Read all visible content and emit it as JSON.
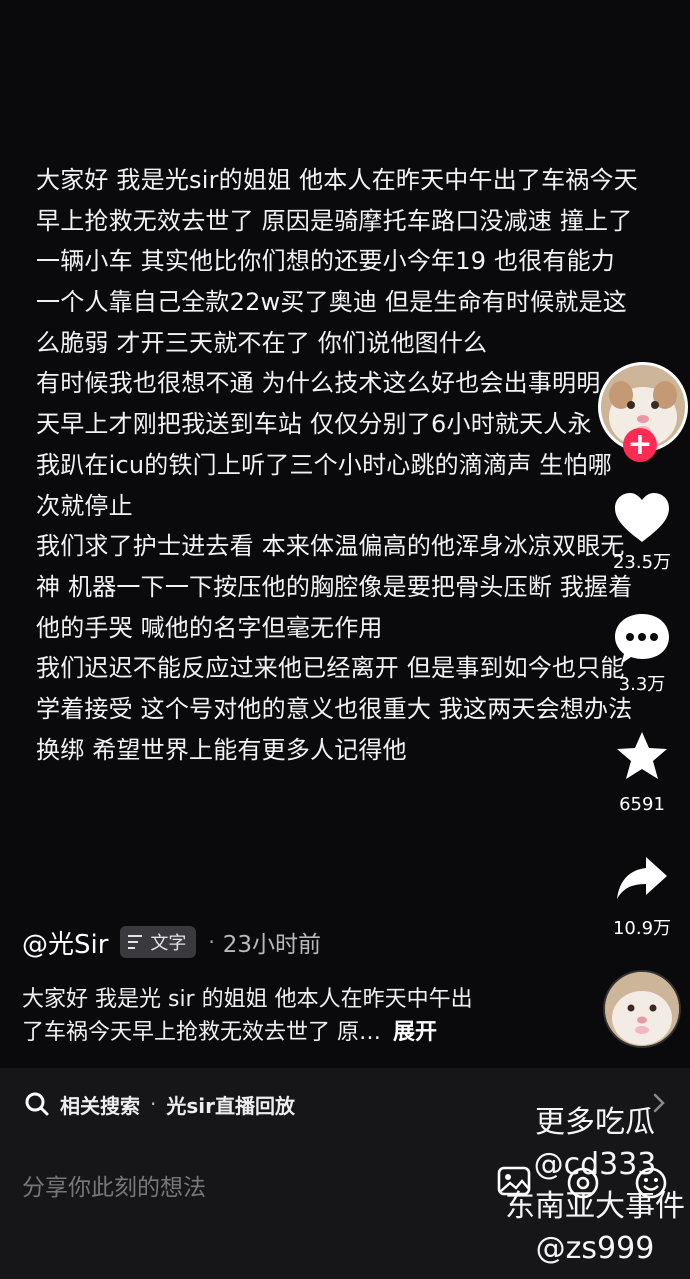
{
  "post": {
    "lines": [
      "大家好 我是光sir的姐姐 他本人在昨天中午出了车祸今天",
      "早上抢救无效去世了 原因是骑摩托车路口没减速 撞上了",
      "一辆小车 其实他比你们想的还要小今年19 也很有能力",
      "一个人靠自己全款22w买了奥迪 但是生命有时候就是这",
      "么脆弱 才开三天就不在了 你们说他图什么",
      "有时候我也很想不通 为什么技术这么好也会出事明明",
      "天早上才刚把我送到车站 仅仅分别了6小时就天人永",
      "我趴在icu的铁门上听了三个小时心跳的滴滴声 生怕哪",
      "次就停止",
      "我们求了护士进去看 本来体温偏高的他浑身冰凉双眼无",
      "神 机器一下一下按压他的胸腔像是要把骨头压断 我握着",
      "他的手哭 喊他的名字但毫无作用",
      "我们迟迟不能反应过来他已经离开 但是事到如今也只能",
      "学着接受 这个号对他的意义也很重大 我这两天会想办法",
      "换绑 希望世界上能有更多人记得他"
    ]
  },
  "actions": {
    "follow_icon": "plus-icon",
    "like_count": "23.5万",
    "comment_count": "3.3万",
    "favorite_count": "6591",
    "share_count": "10.9万"
  },
  "author": {
    "name": "@光Sir",
    "badge": "文字",
    "separator": "·",
    "time_ago": "23小时前"
  },
  "caption": {
    "text_line1": "大家好 我是光 sir 的姐姐 他本人在昨天中午出",
    "text_line2": "了车祸今天早上抢救无效去世了 原…",
    "expand": "展开"
  },
  "related": {
    "label": "相关搜索",
    "dot": "·",
    "query": "光sir直播回放"
  },
  "comment": {
    "placeholder": "分享你此刻的想法"
  },
  "watermark": {
    "line1": "更多吃瓜",
    "line2": "@cd333",
    "line3": "东南亚大事件",
    "line4": "@zs999"
  },
  "colors": {
    "background": "#0a0a0c",
    "accent": "#fe2c55",
    "bottom_bar": "#161618"
  }
}
